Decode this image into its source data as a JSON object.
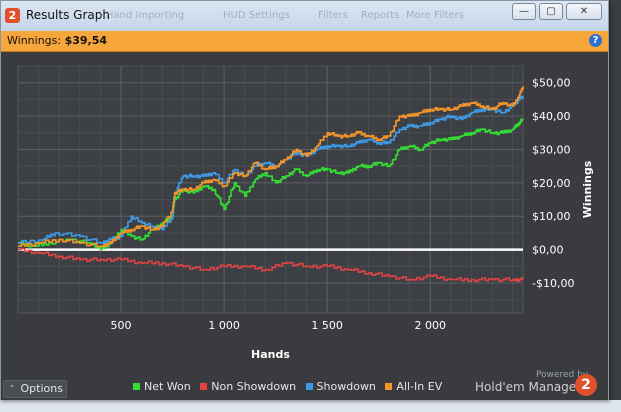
{
  "window": {
    "title": "Results Graph",
    "logo_glyph": "2",
    "controls": {
      "minimize": "—",
      "maximize": "▢",
      "close": "✕"
    }
  },
  "background_menu": [
    "Hand Importing",
    "HUD Settings",
    "Filters",
    "Reports",
    "More Filters"
  ],
  "winnings": {
    "label": "Winnings:",
    "value": "$39,54"
  },
  "help_glyph": "?",
  "chart_data": {
    "type": "line",
    "xlabel": "Hands",
    "ylabel": "Winnings",
    "xlim": [
      0,
      2450
    ],
    "ylim": [
      -19,
      55
    ],
    "x_ticks": [
      500,
      1000,
      1500,
      2000
    ],
    "x_tick_labels": [
      "500",
      "1 000",
      "1 500",
      "2 000"
    ],
    "y_ticks": [
      -10,
      0,
      10,
      20,
      30,
      40,
      50
    ],
    "y_tick_labels": [
      "-$10,00",
      "$0,00",
      "$10,00",
      "$20,00",
      "$30,00",
      "$40,00",
      "$50,00"
    ],
    "grid": true,
    "legend_position": "bottom",
    "series": [
      {
        "name": "Net Won",
        "color": "#33dd33",
        "x": [
          0,
          80,
          150,
          250,
          350,
          400,
          450,
          500,
          550,
          600,
          650,
          700,
          750,
          760,
          800,
          850,
          900,
          950,
          1000,
          1050,
          1100,
          1150,
          1200,
          1250,
          1300,
          1350,
          1400,
          1450,
          1500,
          1550,
          1600,
          1650,
          1700,
          1750,
          1800,
          1850,
          1900,
          1950,
          2000,
          2050,
          2100,
          2150,
          2200,
          2250,
          2300,
          2350,
          2400,
          2430,
          2450
        ],
        "y": [
          2,
          1,
          2,
          3,
          2,
          0,
          2,
          6,
          4,
          3,
          6,
          8,
          10,
          15,
          18,
          17,
          19,
          18,
          12,
          20,
          16,
          21,
          23,
          20,
          22,
          24,
          22,
          24,
          24,
          23,
          23,
          25,
          25,
          26,
          25,
          30,
          31,
          30,
          32,
          33,
          33,
          34,
          35,
          36,
          35,
          35,
          36,
          38,
          39
        ]
      },
      {
        "name": "Non Showdown",
        "color": "#e04444",
        "x": [
          0,
          100,
          200,
          300,
          400,
          500,
          600,
          700,
          800,
          900,
          1000,
          1100,
          1200,
          1300,
          1400,
          1500,
          1600,
          1700,
          1800,
          1900,
          2000,
          2100,
          2200,
          2300,
          2400,
          2450
        ],
        "y": [
          0,
          -1,
          -2,
          -3,
          -3,
          -3,
          -4,
          -4,
          -5,
          -6,
          -5,
          -5,
          -6,
          -4,
          -5,
          -5,
          -6,
          -7,
          -8,
          -9,
          -8,
          -9,
          -9,
          -9,
          -9,
          -9
        ]
      },
      {
        "name": "Showdown",
        "color": "#3e9ae6",
        "x": [
          0,
          120,
          180,
          300,
          400,
          450,
          500,
          550,
          600,
          650,
          700,
          750,
          760,
          800,
          850,
          900,
          950,
          1000,
          1050,
          1100,
          1150,
          1200,
          1250,
          1300,
          1350,
          1400,
          1450,
          1500,
          1550,
          1600,
          1650,
          1700,
          1750,
          1800,
          1850,
          1900,
          1950,
          2000,
          2050,
          2100,
          2150,
          2200,
          2250,
          2300,
          2350,
          2400,
          2430,
          2450
        ],
        "y": [
          2,
          3,
          5,
          4,
          2,
          3,
          4,
          10,
          8,
          7,
          6,
          10,
          17,
          22,
          22,
          22,
          23,
          20,
          24,
          22,
          25,
          26,
          25,
          27,
          29,
          28,
          30,
          31,
          31,
          31,
          32,
          33,
          32,
          32,
          36,
          37,
          37,
          38,
          39,
          40,
          39,
          41,
          42,
          42,
          41,
          43,
          45,
          46
        ]
      },
      {
        "name": "All-In EV",
        "color": "#f4952a",
        "x": [
          0,
          100,
          200,
          300,
          400,
          450,
          500,
          550,
          600,
          650,
          700,
          750,
          760,
          800,
          850,
          900,
          950,
          1000,
          1050,
          1100,
          1150,
          1200,
          1250,
          1300,
          1350,
          1400,
          1450,
          1500,
          1550,
          1600,
          1650,
          1700,
          1750,
          1800,
          1850,
          1900,
          1950,
          2000,
          2050,
          2100,
          2150,
          2200,
          2250,
          2300,
          2350,
          2400,
          2430,
          2450
        ],
        "y": [
          1,
          2,
          3,
          2,
          1,
          2,
          5,
          6,
          7,
          6,
          7,
          12,
          17,
          18,
          18,
          20,
          21,
          19,
          23,
          22,
          26,
          24,
          25,
          27,
          30,
          28,
          31,
          35,
          34,
          34,
          35,
          34,
          33,
          34,
          40,
          40,
          41,
          42,
          42,
          42,
          43,
          44,
          43,
          42,
          44,
          43,
          46,
          49
        ]
      }
    ]
  },
  "footer": {
    "options_label": "Options",
    "options_chevron": "˄",
    "legend": [
      {
        "label": "Net Won",
        "color": "#33dd33"
      },
      {
        "label": "Non Showdown",
        "color": "#e04444"
      },
      {
        "label": "Showdown",
        "color": "#3e9ae6"
      },
      {
        "label": "All-In EV",
        "color": "#f4952a"
      }
    ],
    "powered_by": "Powered by",
    "brand": "Hold'em Manager",
    "brand_glyph": "2"
  }
}
